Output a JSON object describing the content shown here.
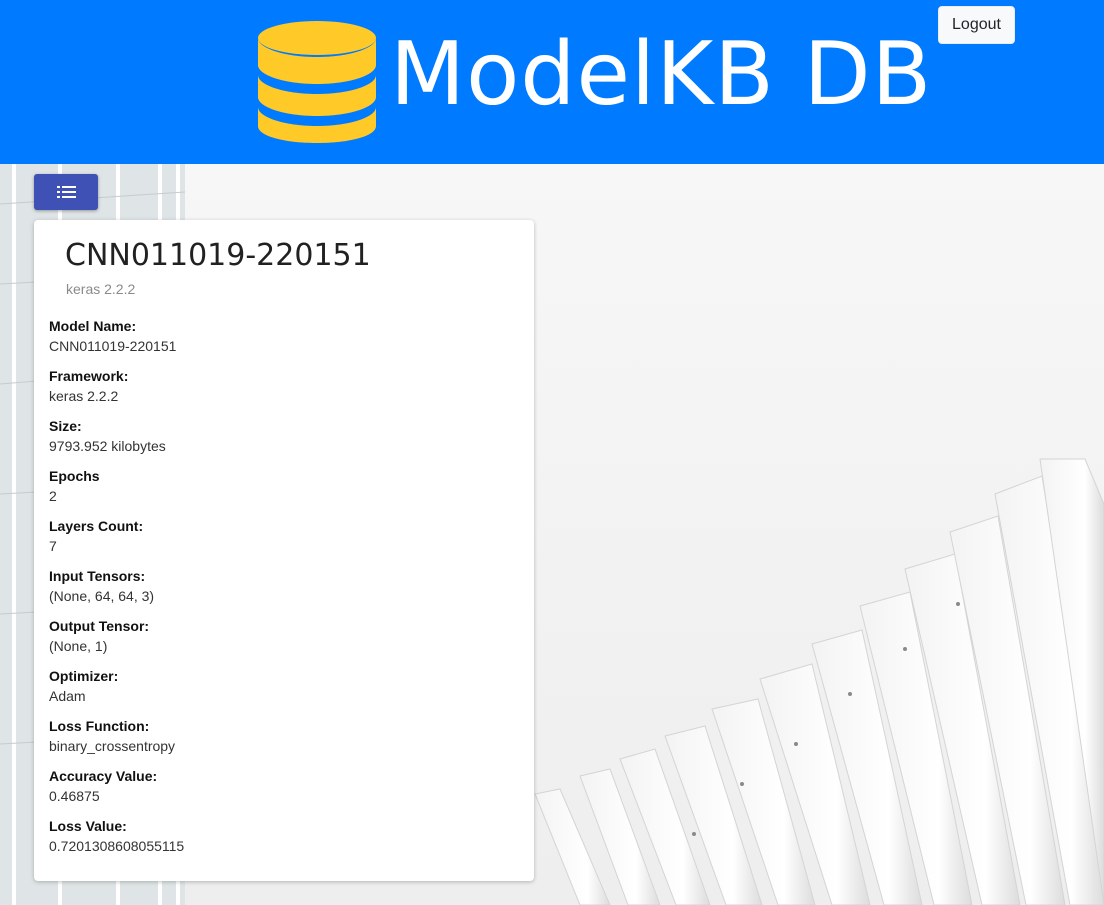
{
  "header": {
    "brand": "ModelKB DB",
    "logout_label": "Logout"
  },
  "colors": {
    "header_bg": "#007bff",
    "logo_fill": "#ffc928",
    "menu_button": "#3f51b5"
  },
  "card": {
    "title": "CNN011019-220151",
    "subtitle": "keras 2.2.2",
    "fields": [
      {
        "label": "Model Name:",
        "value": "CNN011019-220151"
      },
      {
        "label": "Framework:",
        "value": "keras 2.2.2"
      },
      {
        "label": "Size:",
        "value": "9793.952 kilobytes"
      },
      {
        "label": "Epochs",
        "value": "2"
      },
      {
        "label": "Layers Count:",
        "value": "7"
      },
      {
        "label": "Input Tensors:",
        "value": "(None, 64, 64, 3)"
      },
      {
        "label": "Output Tensor:",
        "value": "(None, 1)"
      },
      {
        "label": "Optimizer:",
        "value": "Adam"
      },
      {
        "label": "Loss Function:",
        "value": "binary_crossentropy"
      },
      {
        "label": "Accuracy Value:",
        "value": "0.46875"
      },
      {
        "label": "Loss Value:",
        "value": "0.7201308608055115"
      }
    ]
  },
  "icons": {
    "logo": "database-icon",
    "menu": "list-icon"
  }
}
